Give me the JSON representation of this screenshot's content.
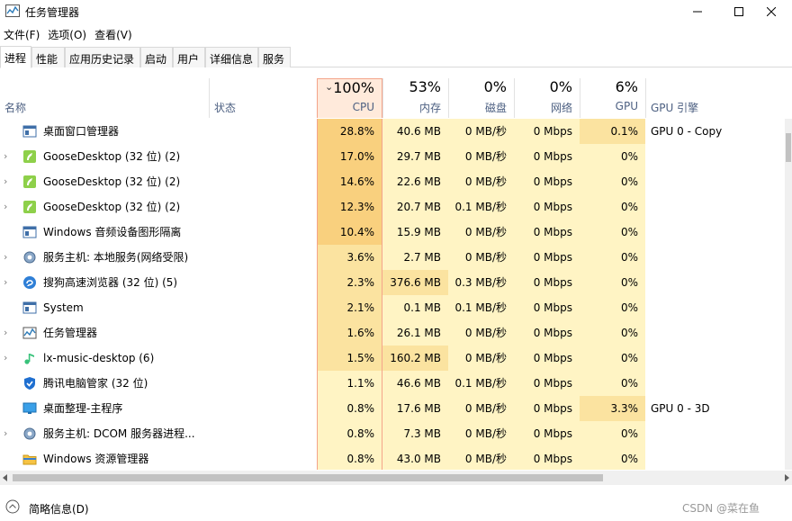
{
  "window": {
    "title": "任务管理器",
    "controls": {
      "minimize": "─",
      "maximize": "☐",
      "close": "✕"
    }
  },
  "menu": [
    "文件(F)",
    "选项(O)",
    "查看(V)"
  ],
  "tabs": [
    "进程",
    "性能",
    "应用历史记录",
    "启动",
    "用户",
    "详细信息",
    "服务"
  ],
  "active_tab": "进程",
  "columns": {
    "name": "名称",
    "status": "状态",
    "cpu": {
      "pct": "100%",
      "label": "CPU"
    },
    "memory": {
      "pct": "53%",
      "label": "内存"
    },
    "disk": {
      "pct": "0%",
      "label": "磁盘"
    },
    "network": {
      "pct": "0%",
      "label": "网络"
    },
    "gpu": {
      "pct": "6%",
      "label": "GPU"
    },
    "gpu_engine": "GPU 引擎"
  },
  "sort_indicator": "⌄",
  "processes": [
    {
      "name": "桌面窗口管理器",
      "icon": "window-icon",
      "expandable": false,
      "cpu": "28.8%",
      "mem": "40.6 MB",
      "disk": "0 MB/秒",
      "net": "0 Mbps",
      "gpu": "0.1%",
      "engine": "GPU 0 - Copy"
    },
    {
      "name": "GooseDesktop (32 位) (2)",
      "icon": "goose-icon",
      "expandable": true,
      "cpu": "17.0%",
      "mem": "29.7 MB",
      "disk": "0 MB/秒",
      "net": "0 Mbps",
      "gpu": "0%",
      "engine": ""
    },
    {
      "name": "GooseDesktop (32 位) (2)",
      "icon": "goose-icon",
      "expandable": true,
      "cpu": "14.6%",
      "mem": "22.6 MB",
      "disk": "0 MB/秒",
      "net": "0 Mbps",
      "gpu": "0%",
      "engine": ""
    },
    {
      "name": "GooseDesktop (32 位) (2)",
      "icon": "goose-icon",
      "expandable": true,
      "cpu": "12.3%",
      "mem": "20.7 MB",
      "disk": "0.1 MB/秒",
      "net": "0 Mbps",
      "gpu": "0%",
      "engine": ""
    },
    {
      "name": "Windows 音频设备图形隔离",
      "icon": "window-icon",
      "expandable": false,
      "cpu": "10.4%",
      "mem": "15.9 MB",
      "disk": "0 MB/秒",
      "net": "0 Mbps",
      "gpu": "0%",
      "engine": ""
    },
    {
      "name": "服务主机: 本地服务(网络受限)",
      "icon": "gear-icon",
      "expandable": true,
      "cpu": "3.6%",
      "mem": "2.7 MB",
      "disk": "0 MB/秒",
      "net": "0 Mbps",
      "gpu": "0%",
      "engine": ""
    },
    {
      "name": "搜狗高速浏览器 (32 位) (5)",
      "icon": "sogou-browser-icon",
      "expandable": true,
      "cpu": "2.3%",
      "mem": "376.6 MB",
      "disk": "0.3 MB/秒",
      "net": "0 Mbps",
      "gpu": "0%",
      "engine": ""
    },
    {
      "name": "System",
      "icon": "window-icon",
      "expandable": false,
      "cpu": "2.1%",
      "mem": "0.1 MB",
      "disk": "0.1 MB/秒",
      "net": "0 Mbps",
      "gpu": "0%",
      "engine": ""
    },
    {
      "name": "任务管理器",
      "icon": "task-manager-icon",
      "expandable": true,
      "cpu": "1.6%",
      "mem": "26.1 MB",
      "disk": "0 MB/秒",
      "net": "0 Mbps",
      "gpu": "0%",
      "engine": ""
    },
    {
      "name": "lx-music-desktop (6)",
      "icon": "music-icon",
      "expandable": true,
      "cpu": "1.5%",
      "mem": "160.2 MB",
      "disk": "0 MB/秒",
      "net": "0 Mbps",
      "gpu": "0%",
      "engine": ""
    },
    {
      "name": "腾讯电脑管家 (32 位)",
      "icon": "shield-icon",
      "expandable": false,
      "cpu": "1.1%",
      "mem": "46.6 MB",
      "disk": "0.1 MB/秒",
      "net": "0 Mbps",
      "gpu": "0%",
      "engine": ""
    },
    {
      "name": "桌面整理-主程序",
      "icon": "monitor-icon",
      "expandable": false,
      "cpu": "0.8%",
      "mem": "17.6 MB",
      "disk": "0 MB/秒",
      "net": "0 Mbps",
      "gpu": "3.3%",
      "engine": "GPU 0 - 3D"
    },
    {
      "name": "服务主机: DCOM 服务器进程...",
      "icon": "gear-icon",
      "expandable": true,
      "cpu": "0.8%",
      "mem": "7.3 MB",
      "disk": "0 MB/秒",
      "net": "0 Mbps",
      "gpu": "0%",
      "engine": ""
    },
    {
      "name": "Windows 资源管理器",
      "icon": "folder-icon",
      "expandable": false,
      "cpu": "0.8%",
      "mem": "43.0 MB",
      "disk": "0 MB/秒",
      "net": "0 Mbps",
      "gpu": "0%",
      "engine": ""
    }
  ],
  "footer": {
    "fewer_details": "简略信息(D)",
    "watermark": "CSDN @菜在鱼"
  },
  "colors": {
    "heat_high": "#f9d07e",
    "heat_mid": "#fbe3a0",
    "heat_low": "#fff4c4",
    "cpu_header_bg": "#ffeadb",
    "cpu_header_border": "#f4a48a",
    "header_label": "#4d6082"
  }
}
